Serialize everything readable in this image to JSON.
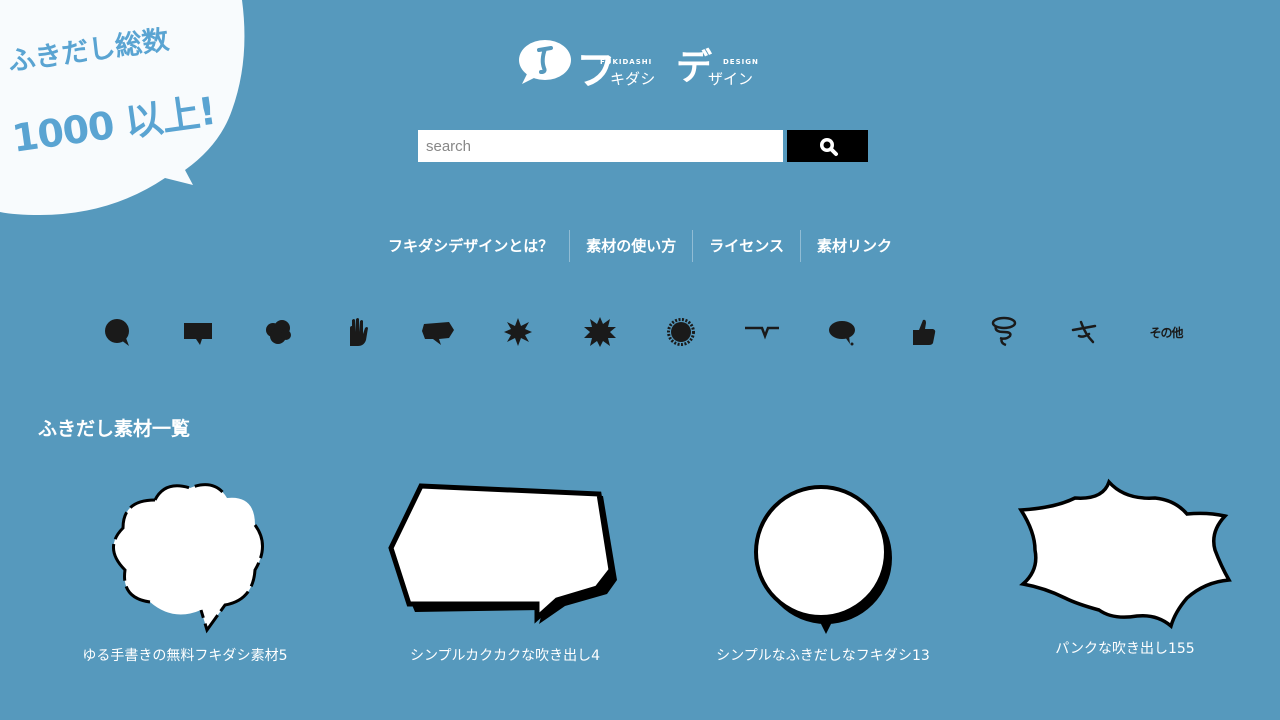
{
  "badge": {
    "line1": "ふきだし総数",
    "line2": "1000 以上!"
  },
  "logo": {
    "mark_icon": "speech-bubble-f-icon",
    "big_f": "フ",
    "sub1": "FUKIDASHI",
    "kana1": "キダシ",
    "big_de": "デ",
    "sub2": "DESIGN",
    "kana2": "ザイン"
  },
  "search": {
    "value": "",
    "placeholder": "search",
    "button_icon": "search-icon"
  },
  "nav": {
    "items": [
      {
        "label": "フキダシデザインとは？"
      },
      {
        "label": "素材の使い方"
      },
      {
        "label": "ライセンス"
      },
      {
        "label": "素材リンク"
      }
    ]
  },
  "categories": {
    "items": [
      {
        "icon": "round-bubble-icon"
      },
      {
        "icon": "square-bubble-icon"
      },
      {
        "icon": "cloud-bubble-icon"
      },
      {
        "icon": "hand-icon"
      },
      {
        "icon": "angular-bubble-icon"
      },
      {
        "icon": "spiky-burst-icon"
      },
      {
        "icon": "explosion-burst-icon"
      },
      {
        "icon": "fuzzy-circle-icon"
      },
      {
        "icon": "line-icon"
      },
      {
        "icon": "small-bubble-icon"
      },
      {
        "icon": "thumbs-up-icon"
      },
      {
        "icon": "swirl-icon"
      },
      {
        "icon": "scribble-icon"
      },
      {
        "icon": "other-icon",
        "label": "その他"
      }
    ]
  },
  "section": {
    "title": "ふきだし素材一覧"
  },
  "cards": [
    {
      "caption": "ゆる手書きの無料フキダシ素材5"
    },
    {
      "caption": "シンプルカクカクな吹き出し4"
    },
    {
      "caption": "シンプルなふきだしなフキダシ13"
    },
    {
      "caption": "パンクな吹き出し155"
    }
  ],
  "colors": {
    "background": "#5699bd",
    "badge_text": "#5aa4d2",
    "icon": "#1a1a1a"
  }
}
